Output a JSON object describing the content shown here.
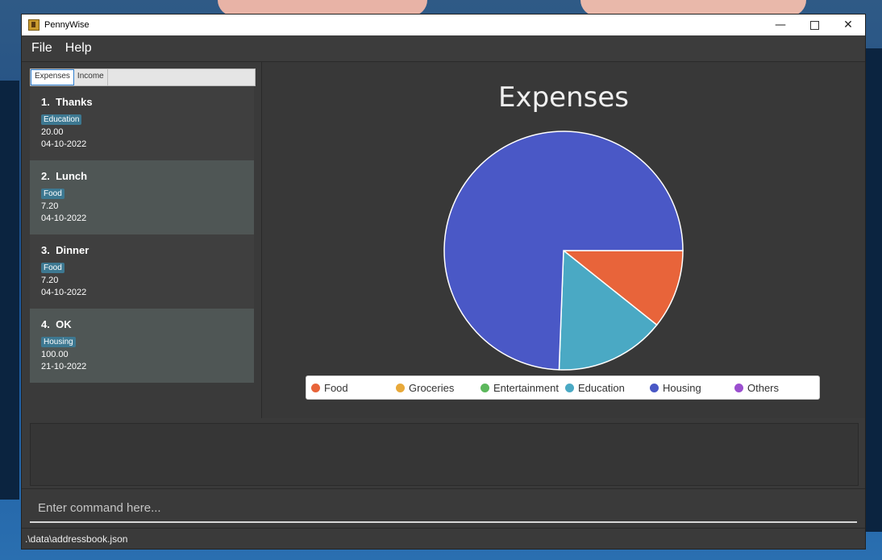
{
  "window": {
    "title": "PennyWise"
  },
  "menu": {
    "file": "File",
    "help": "Help"
  },
  "tabs": {
    "expenses": "Expenses",
    "income": "Income"
  },
  "entries": [
    {
      "index": "1.",
      "description": "Thanks",
      "category": "Education",
      "amount": "20.00",
      "date": "04-10-2022"
    },
    {
      "index": "2.",
      "description": "Lunch",
      "category": "Food",
      "amount": "7.20",
      "date": "04-10-2022"
    },
    {
      "index": "3.",
      "description": "Dinner",
      "category": "Food",
      "amount": "7.20",
      "date": "04-10-2022"
    },
    {
      "index": "4.",
      "description": "OK",
      "category": "Housing",
      "amount": "100.00",
      "date": "21-10-2022"
    }
  ],
  "chart_data": {
    "type": "pie",
    "title": "Expenses",
    "legend_position": "bottom",
    "slices": [
      {
        "label": "Food",
        "value": 14.4,
        "color": "#e8643a"
      },
      {
        "label": "Groceries",
        "value": 0,
        "color": "#e8a93a"
      },
      {
        "label": "Entertainment",
        "value": 0,
        "color": "#5cb85c"
      },
      {
        "label": "Education",
        "value": 20.0,
        "color": "#4aa9c4"
      },
      {
        "label": "Housing",
        "value": 100.0,
        "color": "#4a58c6"
      },
      {
        "label": "Others",
        "value": 0,
        "color": "#9b4fcf"
      }
    ]
  },
  "command": {
    "placeholder": "Enter command here..."
  },
  "status": {
    "path": ".\\data\\addressbook.json"
  }
}
